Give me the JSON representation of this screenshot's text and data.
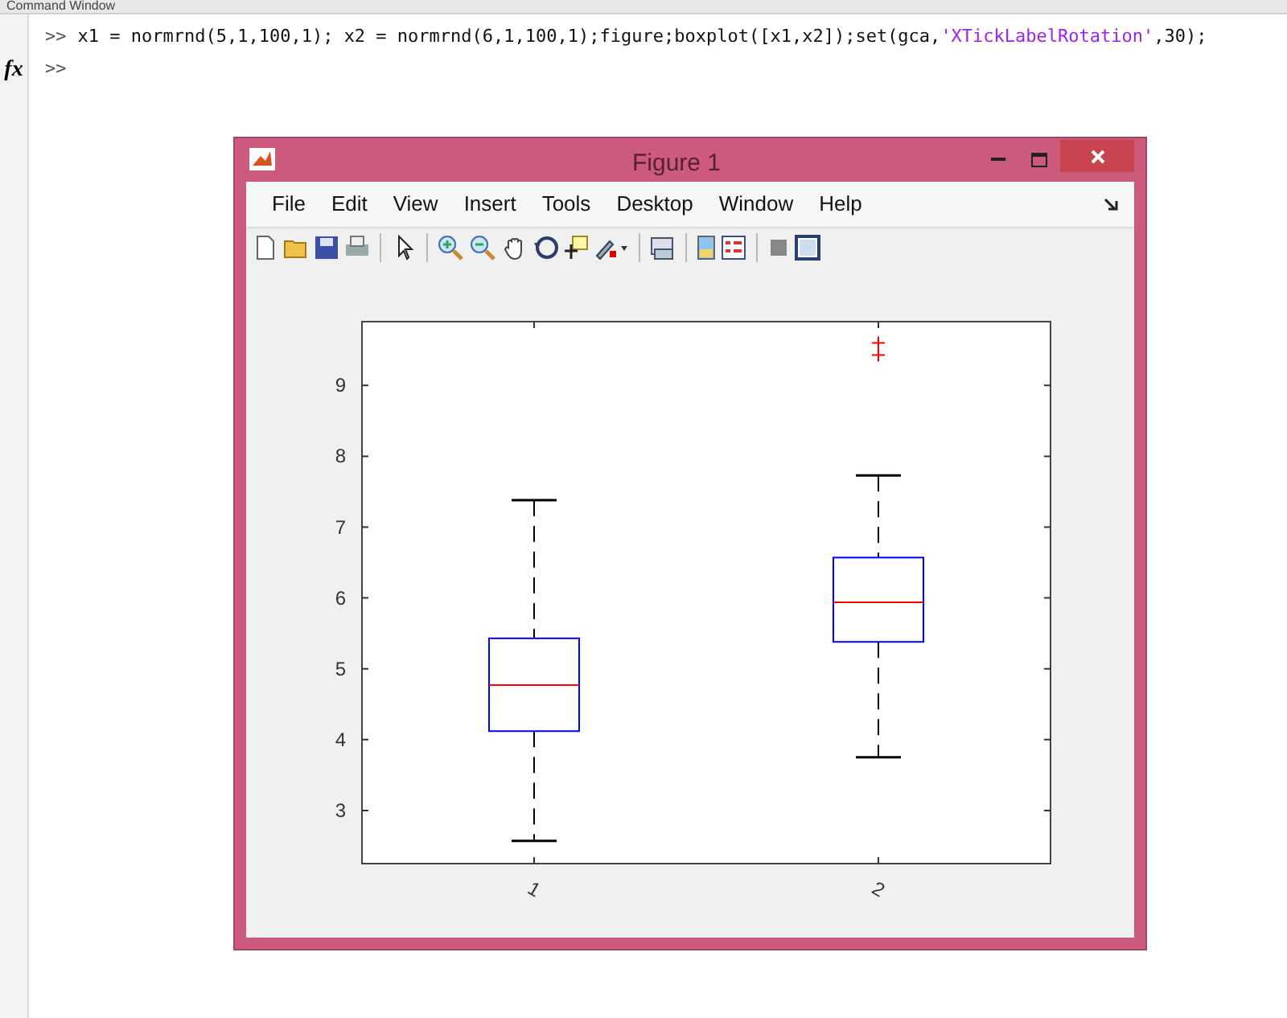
{
  "panel": {
    "title": "Command Window"
  },
  "command_lines": [
    {
      "prompt": ">>",
      "segments": [
        {
          "kind": "code",
          "text": "x1 = normrnd(5,1,100,1); x2 = normrnd(6,1,100,1);figure;boxplot([x1,x2]);set(gca,"
        },
        {
          "kind": "string",
          "text": "'XTickLabelRotation'"
        },
        {
          "kind": "code",
          "text": ",30);"
        }
      ]
    },
    {
      "prompt": ">>"
    }
  ],
  "gutter": {
    "label": "fx"
  },
  "figure": {
    "title": "Figure 1",
    "menu": [
      "File",
      "Edit",
      "View",
      "Insert",
      "Tools",
      "Desktop",
      "Window",
      "Help"
    ],
    "chart_data": {
      "type": "box",
      "categories": [
        "1",
        "2"
      ],
      "ylim": [
        2.25,
        9.9
      ],
      "yticks": [
        3,
        4,
        5,
        6,
        7,
        8,
        9
      ],
      "boxes": [
        {
          "low": 2.57,
          "q1": 4.12,
          "median": 4.77,
          "q3": 5.43,
          "high": 7.38
        },
        {
          "low": 3.75,
          "q1": 5.38,
          "median": 5.94,
          "q3": 6.57,
          "high": 7.73,
          "outliers": [
            9.43,
            9.6
          ]
        }
      ]
    }
  }
}
